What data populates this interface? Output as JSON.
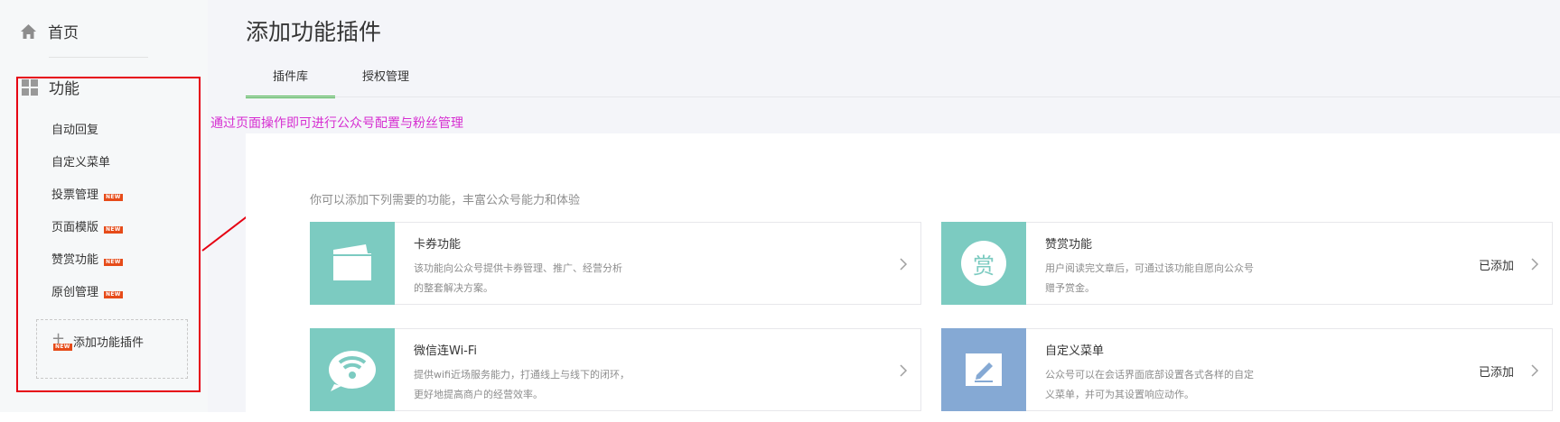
{
  "sidebar": {
    "home_label": "首页",
    "function_label": "功能",
    "items": [
      {
        "label": "自动回复",
        "new": false
      },
      {
        "label": "自定义菜单",
        "new": false
      },
      {
        "label": "投票管理",
        "new": true
      },
      {
        "label": "页面模版",
        "new": true
      },
      {
        "label": "赞赏功能",
        "new": true
      },
      {
        "label": "原创管理",
        "new": true
      }
    ],
    "add_plugin_label": "添加功能插件",
    "new_badge": "NEW"
  },
  "main": {
    "title": "添加功能插件",
    "tabs": [
      {
        "label": "插件库",
        "active": true
      },
      {
        "label": "授权管理",
        "active": false
      }
    ],
    "annotation": "通过页面操作即可进行公众号配置与粉丝管理",
    "intro": "你可以添加下列需要的功能，丰富公众号能力和体验",
    "cards": [
      {
        "title": "卡券功能",
        "desc": "该功能向公众号提供卡券管理、推广、经营分析的整套解决方案。",
        "status": "",
        "icon": "card-icon",
        "color": "#7ccbc1"
      },
      {
        "title": "赞赏功能",
        "desc": "用户阅读完文章后，可通过该功能自愿向公众号赠予赏金。",
        "status": "已添加",
        "icon": "reward-icon",
        "icon_text": "赏",
        "color": "#7ccbc1"
      },
      {
        "title": "微信连Wi-Fi",
        "desc": "提供wifi近场服务能力，打通线上与线下的闭环，更好地提高商户的经营效率。",
        "status": "",
        "icon": "wifi-icon",
        "color": "#7ccbc1"
      },
      {
        "title": "自定义菜单",
        "desc": "公众号可以在会话界面底部设置各式各样的自定义菜单，并可为其设置响应动作。",
        "status": "已添加",
        "icon": "edit-icon",
        "color": "#85a9d4"
      }
    ]
  }
}
